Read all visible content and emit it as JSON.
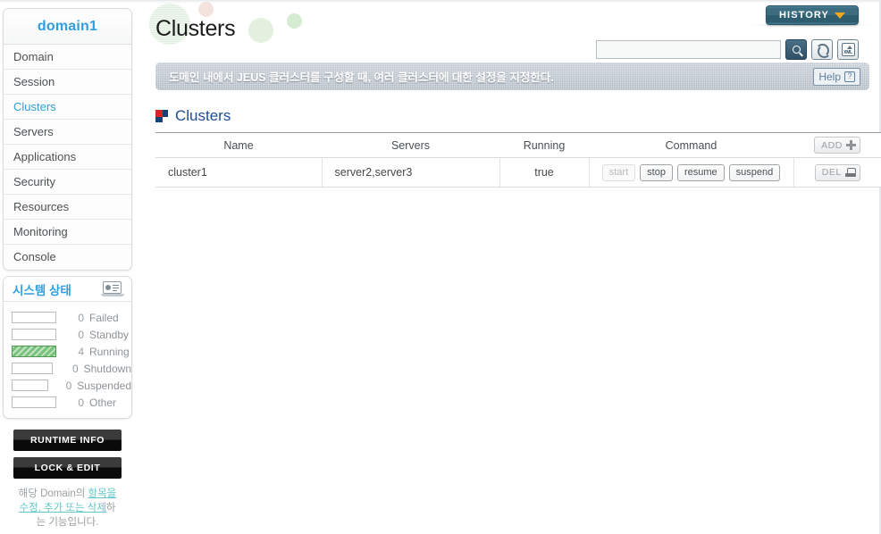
{
  "sidebar": {
    "domain_title": "domain1",
    "nav_items": [
      {
        "label": "Domain",
        "active": false
      },
      {
        "label": "Session",
        "active": false
      },
      {
        "label": "Clusters",
        "active": true
      },
      {
        "label": "Servers",
        "active": false
      },
      {
        "label": "Applications",
        "active": false
      },
      {
        "label": "Security",
        "active": false
      },
      {
        "label": "Resources",
        "active": false
      },
      {
        "label": "Monitoring",
        "active": false
      },
      {
        "label": "Console",
        "active": false
      }
    ],
    "system_status": {
      "title": "시스템 상태",
      "icon": "monitor-chart-icon",
      "rows": [
        {
          "count": "0",
          "label": "Failed",
          "filled": false
        },
        {
          "count": "0",
          "label": "Standby",
          "filled": false
        },
        {
          "count": "4",
          "label": "Running",
          "filled": true
        },
        {
          "count": "0",
          "label": "Shutdown",
          "filled": false
        },
        {
          "count": "0",
          "label": "Suspended",
          "filled": false
        },
        {
          "count": "0",
          "label": "Other",
          "filled": false
        }
      ]
    },
    "runtime_info_label": "RUNTIME INFO",
    "lock_edit_label": "LOCK & EDIT",
    "description": {
      "part1": "해당 Domain의 ",
      "link1": "항목",
      "part2": "",
      "link2": "을 수정, 추가 또는 삭",
      "link3": "제",
      "part3": "하는 기능입니다."
    }
  },
  "header": {
    "page_title": "Clusters",
    "history_label": "HISTORY",
    "history_chevron": "chevron-down-icon"
  },
  "toolbar": {
    "search_value": "",
    "search_placeholder": "",
    "search_icon": "search-icon",
    "sync_icon": "sync-icon",
    "xml_icon": "xml-export-icon"
  },
  "banner": {
    "text": "도메인 내에서 JEUS 클러스터를 구성할 때, 여러 클러스터에 대한 설정을 지정한다.",
    "help_label": "Help",
    "help_icon": "question-mark-icon"
  },
  "section": {
    "icon": "tmax-square-icon",
    "title": "Clusters"
  },
  "table": {
    "columns": [
      "Name",
      "Servers",
      "Running",
      "Command"
    ],
    "add_label": "ADD",
    "add_icon": "plus-icon",
    "del_label": "DEL",
    "del_icon": "delete-icon",
    "rows": [
      {
        "name": "cluster1",
        "servers": "server2,server3",
        "running": "true",
        "commands": [
          {
            "label": "start",
            "disabled": true
          },
          {
            "label": "stop",
            "disabled": false
          },
          {
            "label": "resume",
            "disabled": false
          },
          {
            "label": "suspend",
            "disabled": false
          }
        ]
      }
    ]
  },
  "colors": {
    "accent_blue": "#2f9fe0",
    "section_blue": "#1c4f95",
    "running_green": "#79c27b",
    "history_teal": "#3d6d80",
    "chevron_orange": "#f4a61f"
  }
}
